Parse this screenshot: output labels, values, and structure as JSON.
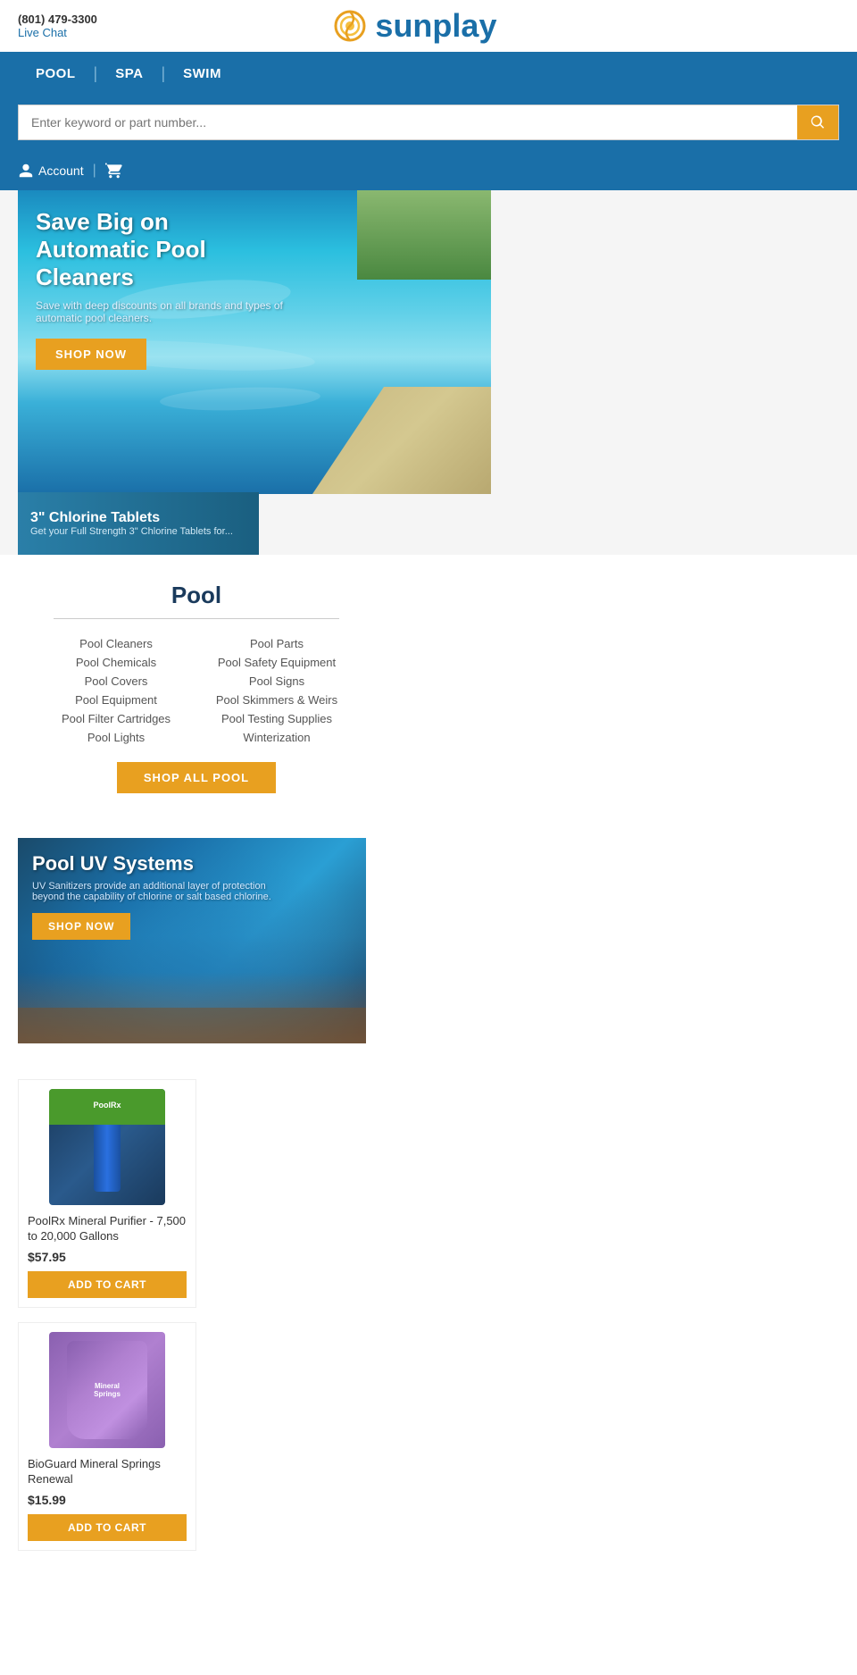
{
  "topbar": {
    "phone": "(801) 479-3300",
    "livechat": "Live Chat"
  },
  "logo": {
    "text": "sunplay"
  },
  "nav": {
    "items": [
      {
        "label": "POOL",
        "href": "#"
      },
      {
        "label": "SPA",
        "href": "#"
      },
      {
        "label": "SWIM",
        "href": "#"
      }
    ]
  },
  "search": {
    "placeholder": "Enter keyword or part number..."
  },
  "account": {
    "label": "Account"
  },
  "hero": {
    "title": "Save Big on Automatic Pool Cleaners",
    "subtitle": "Save with deep discounts on all brands and types of automatic pool cleaners.",
    "btn_label": "SHOP NOW"
  },
  "mini_banner": {
    "title": "3\" Chlorine Tablets",
    "subtitle": "Get your Full Strength 3\" Chlorine Tablets for..."
  },
  "pool_category": {
    "title": "Pool",
    "links_col1": [
      "Pool Cleaners",
      "Pool Chemicals",
      "Pool Covers",
      "Pool Equipment",
      "Pool Filter Cartridges",
      "Pool Lights"
    ],
    "links_col2": [
      "Pool Parts",
      "Pool Safety Equipment",
      "Pool Signs",
      "Pool Skimmers & Weirs",
      "Pool Testing Supplies",
      "Winterization"
    ],
    "shop_btn": "SHOP ALL POOL"
  },
  "uv_banner": {
    "title": "Pool UV Systems",
    "subtitle": "UV Sanitizers provide an additional layer of protection beyond the capability of chlorine or salt based chlorine.",
    "btn_label": "SHOP NOW"
  },
  "products": [
    {
      "id": "poolrx",
      "name": "PoolRx Mineral Purifier - 7,500 to 20,000 Gallons",
      "price": "$57.95",
      "btn_label": "ADD TO CART",
      "img_type": "poolrx"
    },
    {
      "id": "bioguard",
      "name": "BioGuard Mineral Springs Renewal",
      "price": "$15.99",
      "btn_label": "ADD TO CART",
      "img_type": "bioguard"
    }
  ],
  "colors": {
    "nav_bg": "#1a6fa8",
    "accent_orange": "#e8a020",
    "text_dark": "#1a3a5c"
  }
}
